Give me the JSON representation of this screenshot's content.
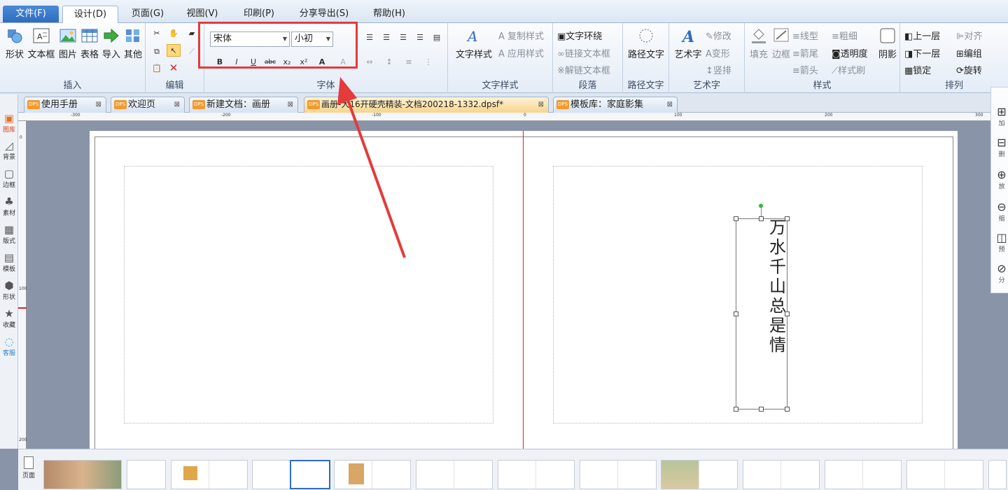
{
  "menubar": {
    "file": "文件(F)",
    "items": [
      "设计(D)",
      "页面(G)",
      "视图(V)",
      "印刷(P)",
      "分享导出(S)",
      "帮助(H)"
    ]
  },
  "ribbon": {
    "insert": {
      "label": "插入",
      "buttons": [
        "形状",
        "文本框",
        "图片",
        "表格",
        "导入",
        "其他"
      ]
    },
    "edit": {
      "label": "编辑"
    },
    "font": {
      "label": "字体",
      "font_name": "宋体",
      "font_size": "小初",
      "bold": "B",
      "italic": "I",
      "underline": "U",
      "strike": "abc",
      "sub": "x₂",
      "sup": "x²",
      "color": "A",
      "shade": "A"
    },
    "textstyle": {
      "label": "文字样式",
      "big": "文字样式",
      "copy": "复制样式",
      "apply": "应用样式"
    },
    "paragraph": {
      "label": "段落",
      "wrap": "文字环绕",
      "link": "链接文本框",
      "unlink": "解链文本框"
    },
    "pathtext": {
      "label": "路径文字",
      "big": "路径文字"
    },
    "arttext": {
      "label": "艺术字",
      "big": "艺术字",
      "modify": "修改",
      "deform": "变形",
      "vertical": "竖排"
    },
    "style": {
      "label": "样式",
      "fill": "填充",
      "border": "边框",
      "linetype": "线型",
      "linewidth": "粗细",
      "tail": "箭尾",
      "transparency": "透明度",
      "head": "箭头",
      "brush": "样式刷",
      "shadow": "阴影"
    },
    "arrange": {
      "label": "排列",
      "up": "上一层",
      "align": "对齐",
      "down": "下一层",
      "group": "编组",
      "lock": "锁定",
      "rotate": "旋转"
    }
  },
  "tabs": [
    {
      "label": "使用手册"
    },
    {
      "label": "欢迎页"
    },
    {
      "label": "新建文档：画册"
    },
    {
      "label": "画册-大16开硬壳精装-文档200218-1332.dpsf*"
    },
    {
      "label": "模板库：家庭影集"
    }
  ],
  "dps_badge": "DPS",
  "leftpanel": [
    "图库",
    "背景",
    "边框",
    "素材",
    "版式",
    "模板",
    "形状",
    "收藏",
    "客服"
  ],
  "ruler": {
    "h": [
      "-300",
      "-200",
      "-100",
      "0",
      "100",
      "200",
      "300"
    ],
    "v": [
      "0",
      "100",
      "200"
    ]
  },
  "canvas": {
    "text_chars": [
      "万",
      "水",
      "千",
      "山",
      "总",
      "是",
      "情"
    ]
  },
  "rightpanel": [
    "加",
    "删",
    "放",
    "缩",
    "预",
    "分"
  ],
  "thumbbar": {
    "pages_label": "页面"
  },
  "colors": {
    "highlight": "#e43b3b",
    "spine": "#dd2222",
    "accent": "#2f6cbf"
  }
}
